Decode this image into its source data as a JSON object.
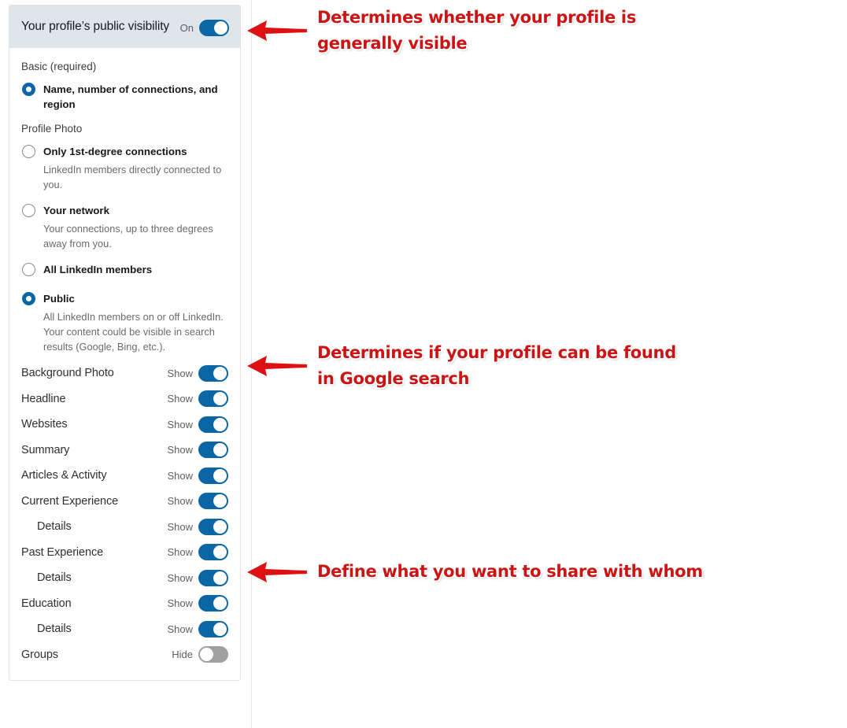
{
  "card": {
    "header": {
      "title": "Your profile’s public visibility",
      "toggle_state_label": "On",
      "toggle_on": true
    },
    "basic_group_label": "Basic (required)",
    "basic_option": {
      "label": "Name, number of connections, and region",
      "checked": true
    },
    "photo_group_label": "Profile Photo",
    "photo_options": [
      {
        "label": "Only 1st-degree connections",
        "description": "LinkedIn members directly connected to you.",
        "checked": false
      },
      {
        "label": "Your network",
        "description": "Your connections, up to three degrees away from you.",
        "checked": false
      },
      {
        "label": "All LinkedIn members",
        "description": "",
        "checked": false
      },
      {
        "label": "Public",
        "description": "All LinkedIn members on or off LinkedIn. Your content could be visible in search results (Google, Bing, etc.).",
        "checked": true
      }
    ],
    "sections": [
      {
        "label": "Background Photo",
        "state": "Show",
        "on": true,
        "indent": false
      },
      {
        "label": "Headline",
        "state": "Show",
        "on": true,
        "indent": false
      },
      {
        "label": "Websites",
        "state": "Show",
        "on": true,
        "indent": false
      },
      {
        "label": "Summary",
        "state": "Show",
        "on": true,
        "indent": false
      },
      {
        "label": "Articles & Activity",
        "state": "Show",
        "on": true,
        "indent": false
      },
      {
        "label": "Current Experience",
        "state": "Show",
        "on": true,
        "indent": false
      },
      {
        "label": "Details",
        "state": "Show",
        "on": true,
        "indent": true
      },
      {
        "label": "Past Experience",
        "state": "Show",
        "on": true,
        "indent": false
      },
      {
        "label": "Details",
        "state": "Show",
        "on": true,
        "indent": true
      },
      {
        "label": "Education",
        "state": "Show",
        "on": true,
        "indent": false
      },
      {
        "label": "Details",
        "state": "Show",
        "on": true,
        "indent": true
      },
      {
        "label": "Groups",
        "state": "Hide",
        "on": false,
        "indent": false
      }
    ]
  },
  "annotations": [
    {
      "id": "visibility",
      "text": "Determines whether your profile is\ngenerally visible"
    },
    {
      "id": "public",
      "text": "Determines if your profile can be found\nin Google search"
    },
    {
      "id": "share",
      "text": "Define what you want to share with whom"
    }
  ],
  "colors": {
    "toggle_on": "#0a66a4",
    "toggle_off": "#a0a0a0",
    "radio_checked": "#0a66a4",
    "header_bg": "#dee5eb",
    "annotation_red": "#cc1414"
  }
}
